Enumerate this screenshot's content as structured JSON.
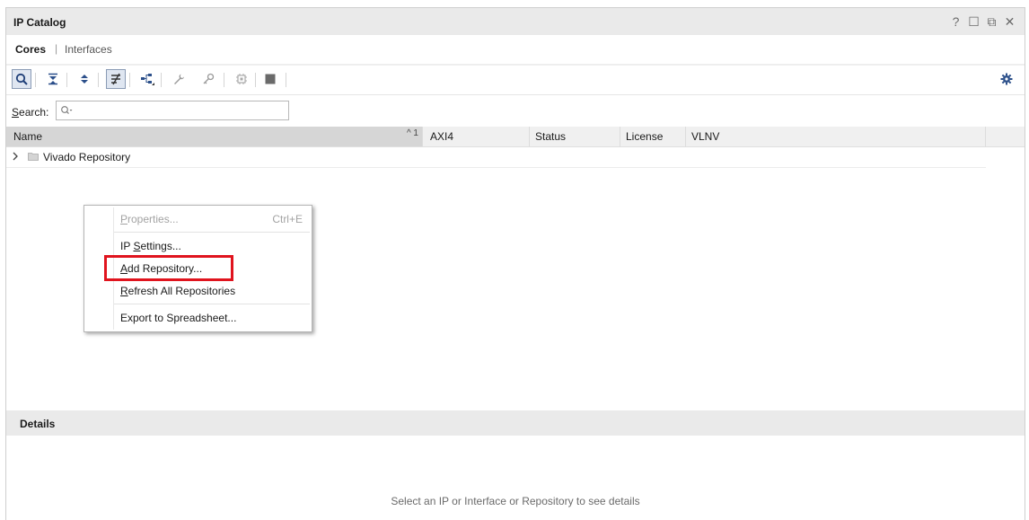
{
  "panel": {
    "title": "IP Catalog",
    "window_controls": [
      "?",
      "☐",
      "⧉",
      "✕"
    ]
  },
  "tabs": [
    {
      "label": "Cores",
      "active": true
    },
    {
      "label": "Interfaces",
      "active": false
    }
  ],
  "toolbar": {
    "icons": [
      "search-icon",
      "collapse-all-icon",
      "expand-all-icon",
      "filter-icon",
      "hierarchy-icon",
      "wrench-icon",
      "key-icon",
      "chip-icon",
      "block-icon",
      "gear-icon"
    ]
  },
  "search": {
    "label_prefix": "S",
    "label_rest": "earch:",
    "value": ""
  },
  "table": {
    "columns": [
      "Name",
      "AXI4",
      "Status",
      "License",
      "VLNV"
    ],
    "sort_indicator": "^ 1",
    "rows": [
      {
        "name": "Vivado Repository"
      }
    ]
  },
  "context_menu": {
    "items": [
      {
        "pre": "",
        "acc": "P",
        "post": "roperties...",
        "shortcut": "Ctrl+E",
        "enabled": false
      },
      {
        "pre": "IP ",
        "acc": "S",
        "post": "ettings...",
        "shortcut": "",
        "enabled": true
      },
      {
        "pre": "",
        "acc": "A",
        "post": "dd Repository...",
        "shortcut": "",
        "enabled": true,
        "highlighted": true
      },
      {
        "pre": "",
        "acc": "R",
        "post": "efresh All Repositories",
        "shortcut": "",
        "enabled": true
      },
      {
        "pre": "",
        "acc": "",
        "post": "Export to Spreadsheet...",
        "shortcut": "",
        "enabled": true
      }
    ]
  },
  "details": {
    "title": "Details",
    "hint": "Select an IP or Interface or Repository to see details"
  },
  "colors": {
    "highlight_box": "#e0141e",
    "accent": "#2b5797"
  }
}
